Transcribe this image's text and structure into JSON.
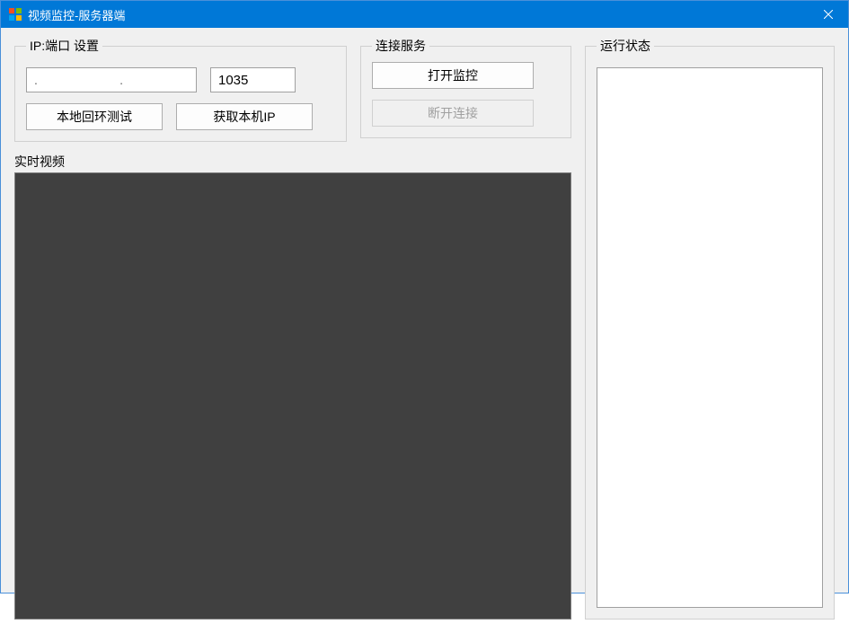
{
  "window": {
    "title": "视频监控-服务器端"
  },
  "ip_port": {
    "legend": "IP:端口 设置",
    "ip_value": ".       .       .",
    "port_value": "1035",
    "loopback_btn": "本地回环测试",
    "get_ip_btn": "获取本机IP"
  },
  "connect": {
    "legend": "连接服务",
    "open_monitor_btn": "打开监控",
    "disconnect_btn": "断开连接"
  },
  "video": {
    "label": "实时视频"
  },
  "status": {
    "legend": "运行状态"
  }
}
